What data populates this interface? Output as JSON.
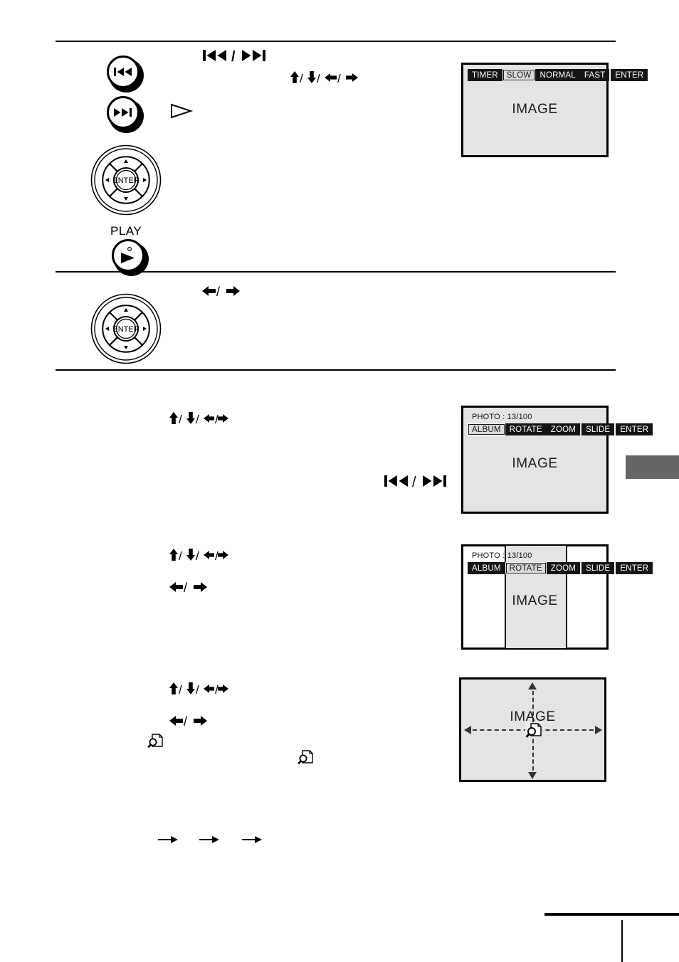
{
  "panels": {
    "slideshow": {
      "caption": "",
      "menu": [
        {
          "label": "TIMER",
          "selected": false
        },
        {
          "label": "SLOW",
          "selected": true
        },
        {
          "label": "NORMAL",
          "selected": false
        },
        {
          "label": "FAST",
          "selected": false
        },
        {
          "label": "ENTER",
          "selected": false
        }
      ],
      "image_label": "IMAGE"
    },
    "photo_album": {
      "caption": "PHOTO : 13/100",
      "menu": [
        {
          "label": "ALBUM",
          "selected": true
        },
        {
          "label": "ROTATE",
          "selected": false
        },
        {
          "label": "ZOOM",
          "selected": false
        },
        {
          "label": "SLIDE",
          "selected": false
        },
        {
          "label": "ENTER",
          "selected": false
        }
      ],
      "image_label": "IMAGE"
    },
    "photo_rotate": {
      "caption": "PHOTO : 13/100",
      "menu": [
        {
          "label": "ALBUM",
          "selected": false
        },
        {
          "label": "ROTATE",
          "selected": true
        },
        {
          "label": "ZOOM",
          "selected": false
        },
        {
          "label": "SLIDE",
          "selected": false
        },
        {
          "label": "ENTER",
          "selected": false
        }
      ],
      "image_label": "IMAGE"
    },
    "photo_zoom": {
      "image_label": "IMAGE",
      "cursor_icon": "magnifier-document-icon"
    }
  },
  "remote": {
    "prev_button": "prev-track-icon",
    "next_button": "next-track-icon",
    "dpad_center_label": "ENTER",
    "play_label": "PLAY",
    "play_button": "play-triangle-icon"
  },
  "glyphs": {
    "skip_pair": "❙◀◀ / ▶▶❙",
    "four_arrows": "⬆ / ⬇ / ⬅ / ➡",
    "lr_arrows": "⬅ / ➡",
    "play_triangle": "▷",
    "right_arrow": "→"
  },
  "colors": {
    "screen_bg": "#e2e4e5",
    "menu_bg": "#151515",
    "menu_selected_bg": "#d9dbdc",
    "edge_tab": "#666666",
    "ink": "#000000"
  }
}
